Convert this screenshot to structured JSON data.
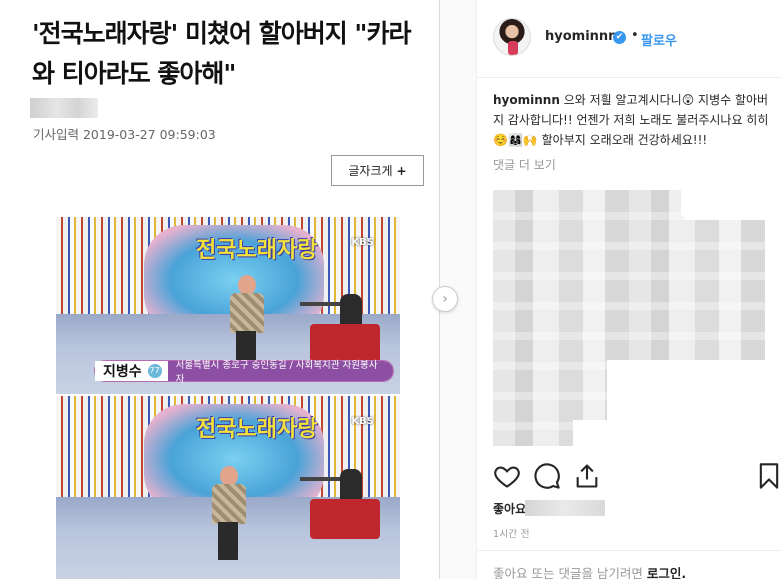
{
  "article": {
    "headline": "'전국노래자랑' 미쳤어 할아버지 \"카라와 티아라도 좋아해\"",
    "date": "기사입력 2019-03-27 09:59:03",
    "font_size_label": "글자크게",
    "font_size_plus": "+",
    "photo_1": {
      "logo": "전국노래자랑",
      "broadcaster": "KBS",
      "caption_name": "지병수",
      "caption_number": "77",
      "caption_location": "서울특별시 종로구 숭인동길 / 사회복지관 자원봉사자"
    },
    "photo_2": {
      "logo": "전국노래자랑",
      "broadcaster": "KBS"
    }
  },
  "carousel": {
    "next_icon": "chevron-right-icon",
    "next_glyph": "›"
  },
  "instagram": {
    "username": "hyominnn",
    "verified_glyph": "✔",
    "separator": "•",
    "follow_label": "팔로우",
    "comment_user": "hyominnn",
    "comment_body": "으와 저흴 알고계시다니😲 지병수 할아버지 감사합니다!! 언젠가 저희 노래도 불러주시나요 히히☺️👩‍👩‍👧🙌 할아부지 오래오래 건강하세요!!!",
    "more_comments": "댓글 더 보기",
    "likes_label": "좋아요",
    "time_ago": "1시간 전",
    "login_prompt": "좋아요 또는 댓글을 남기려면",
    "login_link": "로그인."
  },
  "colors": {
    "follow_blue": "#3897f0",
    "verified_blue": "#3897f0",
    "caption_purple": "#8c4fa3"
  }
}
